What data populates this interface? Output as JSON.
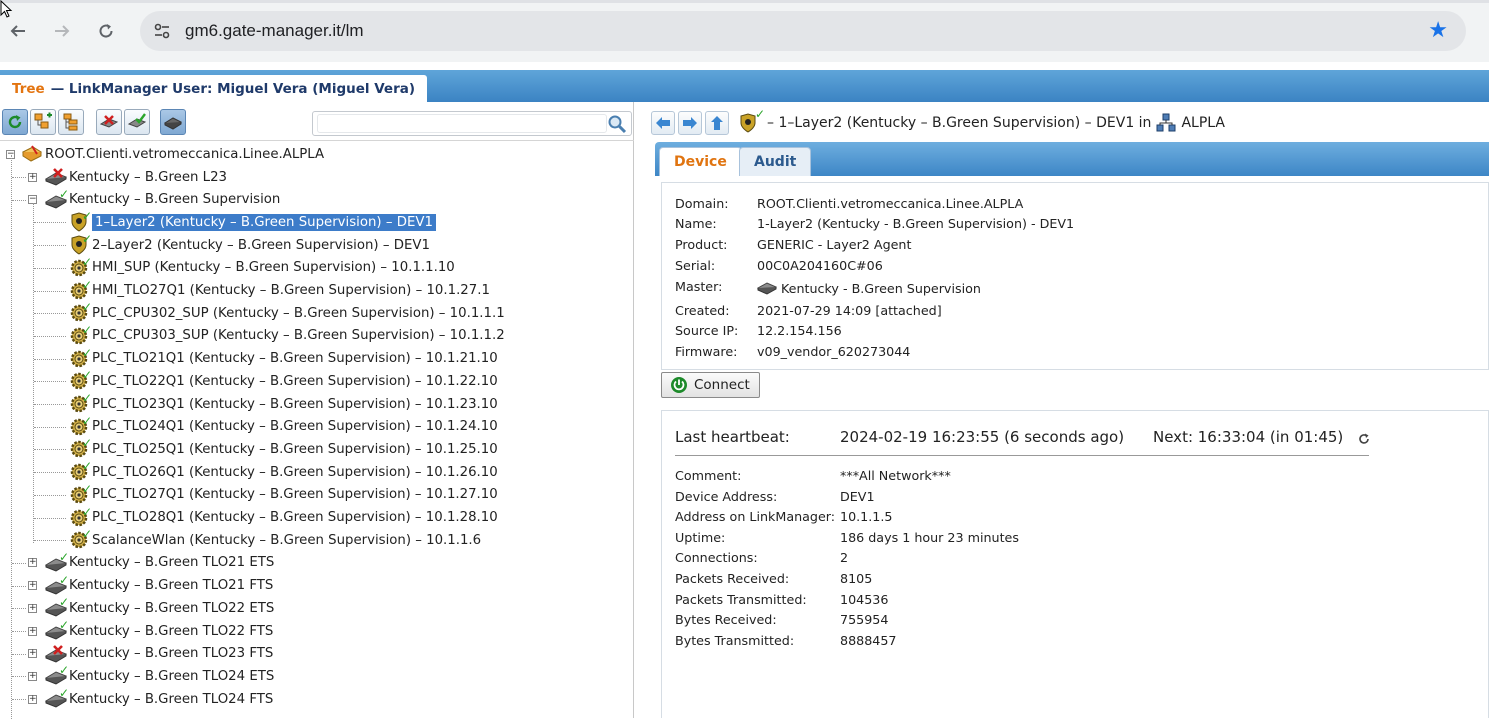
{
  "browser": {
    "url": "gm6.gate-manager.it/lm",
    "back_icon": "arrow-left-icon",
    "forward_icon": "arrow-right-icon",
    "reload_icon": "reload-icon",
    "site_info_icon": "tune-icon",
    "bookmark_icon": "star-icon"
  },
  "app": {
    "tree_tab_word": "Tree",
    "tree_tab_title": "— LinkManager User: Miguel Vera (Miguel Vera)"
  },
  "search": {
    "placeholder": ""
  },
  "tree": {
    "root": "ROOT.Clienti.vetromeccanica.Linee.ALPLA",
    "nodes": [
      {
        "label": "Kentucky – B.Green L23",
        "level": 1,
        "icon": "router-red-icon",
        "expander": "+"
      },
      {
        "label": "Kentucky – B.Green Supervision",
        "level": 1,
        "icon": "router-ok-icon",
        "expander": "-"
      },
      {
        "label": "1–Layer2 (Kentucky – B.Green Supervision) – DEV1",
        "level": 2,
        "icon": "shield-agent-icon",
        "selected": true
      },
      {
        "label": "2–Layer2 (Kentucky – B.Green Supervision) – DEV1",
        "level": 2,
        "icon": "shield-agent-icon"
      },
      {
        "label": "HMI_SUP (Kentucky – B.Green Supervision) – 10.1.1.10",
        "level": 2,
        "icon": "gear-agent-icon"
      },
      {
        "label": "HMI_TLO27Q1 (Kentucky – B.Green Supervision) – 10.1.27.1",
        "level": 2,
        "icon": "gear-agent-icon"
      },
      {
        "label": "PLC_CPU302_SUP (Kentucky – B.Green Supervision) – 10.1.1.1",
        "level": 2,
        "icon": "gear-agent-icon"
      },
      {
        "label": "PLC_CPU303_SUP (Kentucky – B.Green Supervision) – 10.1.1.2",
        "level": 2,
        "icon": "gear-agent-icon"
      },
      {
        "label": "PLC_TLO21Q1 (Kentucky – B.Green Supervision) – 10.1.21.10",
        "level": 2,
        "icon": "gear-agent-icon"
      },
      {
        "label": "PLC_TLO22Q1 (Kentucky – B.Green Supervision) – 10.1.22.10",
        "level": 2,
        "icon": "gear-agent-icon"
      },
      {
        "label": "PLC_TLO23Q1 (Kentucky – B.Green Supervision) – 10.1.23.10",
        "level": 2,
        "icon": "gear-agent-icon"
      },
      {
        "label": "PLC_TLO24Q1 (Kentucky – B.Green Supervision) – 10.1.24.10",
        "level": 2,
        "icon": "gear-agent-icon"
      },
      {
        "label": "PLC_TLO25Q1 (Kentucky – B.Green Supervision) – 10.1.25.10",
        "level": 2,
        "icon": "gear-agent-icon"
      },
      {
        "label": "PLC_TLO26Q1 (Kentucky – B.Green Supervision) – 10.1.26.10",
        "level": 2,
        "icon": "gear-agent-icon"
      },
      {
        "label": "PLC_TLO27Q1 (Kentucky – B.Green Supervision) – 10.1.27.10",
        "level": 2,
        "icon": "gear-agent-icon"
      },
      {
        "label": "PLC_TLO28Q1 (Kentucky – B.Green Supervision) – 10.1.28.10",
        "level": 2,
        "icon": "gear-agent-icon"
      },
      {
        "label": "ScalanceWlan (Kentucky – B.Green Supervision) – 10.1.1.6",
        "level": 2,
        "icon": "gear-agent-icon"
      },
      {
        "label": "Kentucky – B.Green TLO21 ETS",
        "level": 1,
        "icon": "router-ok-icon",
        "expander": "+"
      },
      {
        "label": "Kentucky – B.Green TLO21 FTS",
        "level": 1,
        "icon": "router-ok-icon",
        "expander": "+"
      },
      {
        "label": "Kentucky – B.Green TLO22 ETS",
        "level": 1,
        "icon": "router-ok-icon",
        "expander": "+"
      },
      {
        "label": "Kentucky – B.Green TLO22 FTS",
        "level": 1,
        "icon": "router-ok-icon",
        "expander": "+"
      },
      {
        "label": "Kentucky – B.Green TLO23 FTS",
        "level": 1,
        "icon": "router-red-icon",
        "expander": "+"
      },
      {
        "label": "Kentucky – B.Green TLO24 ETS",
        "level": 1,
        "icon": "router-ok-icon",
        "expander": "+"
      },
      {
        "label": "Kentucky – B.Green TLO24 FTS",
        "level": 1,
        "icon": "router-ok-icon",
        "expander": "+"
      }
    ]
  },
  "breadcrumb": {
    "text": "– 1–Layer2 (Kentucky – B.Green Supervision) – DEV1 in",
    "domain": "ALPLA"
  },
  "tabs": [
    {
      "label": "Device",
      "active": true
    },
    {
      "label": "Audit",
      "active": false
    }
  ],
  "device": {
    "fields": [
      {
        "key": "Domain:",
        "value": "ROOT.Clienti.vetromeccanica.Linee.ALPLA"
      },
      {
        "key": "Name:",
        "value": "1-Layer2 (Kentucky - B.Green Supervision) - DEV1"
      },
      {
        "key": "Product:",
        "value": "GENERIC - Layer2 Agent"
      },
      {
        "key": "Serial:",
        "value": "00C0A204160C#06"
      },
      {
        "key": "Master:",
        "value": "Kentucky - B.Green Supervision"
      },
      {
        "key": "Created:",
        "value": "2021-07-29 14:09  [attached]"
      },
      {
        "key": "Source IP:",
        "value": "12.2.154.156"
      },
      {
        "key": "Firmware:",
        "value": "v09_vendor_620273044"
      }
    ],
    "connect_label": "Connect"
  },
  "status": {
    "heartbeat_label": "Last heartbeat:",
    "heartbeat_value": "2024-02-19 16:23:55 (6 seconds ago)",
    "next_label": "Next: 16:33:04 (in 01:45)",
    "fields": [
      {
        "key": "Comment:",
        "value": "***All Network***"
      },
      {
        "key": "Device Address:",
        "value": "DEV1"
      },
      {
        "key": "Address on LinkManager:",
        "value": "10.1.1.5"
      },
      {
        "key": "Uptime:",
        "value": "186 days 1 hour 23 minutes"
      },
      {
        "key": "Connections:",
        "value": "2"
      },
      {
        "key": "Packets Received:",
        "value": "8105"
      },
      {
        "key": "Packets Transmitted:",
        "value": "104536"
      },
      {
        "key": "Bytes Received:",
        "value": "755954"
      },
      {
        "key": "Bytes Transmitted:",
        "value": "8888457"
      }
    ]
  },
  "colors": {
    "accent_blue": "#3b83c3",
    "tab_orange": "#e07410",
    "check_green": "#2ba52b",
    "selection": "#3d7cc9"
  }
}
